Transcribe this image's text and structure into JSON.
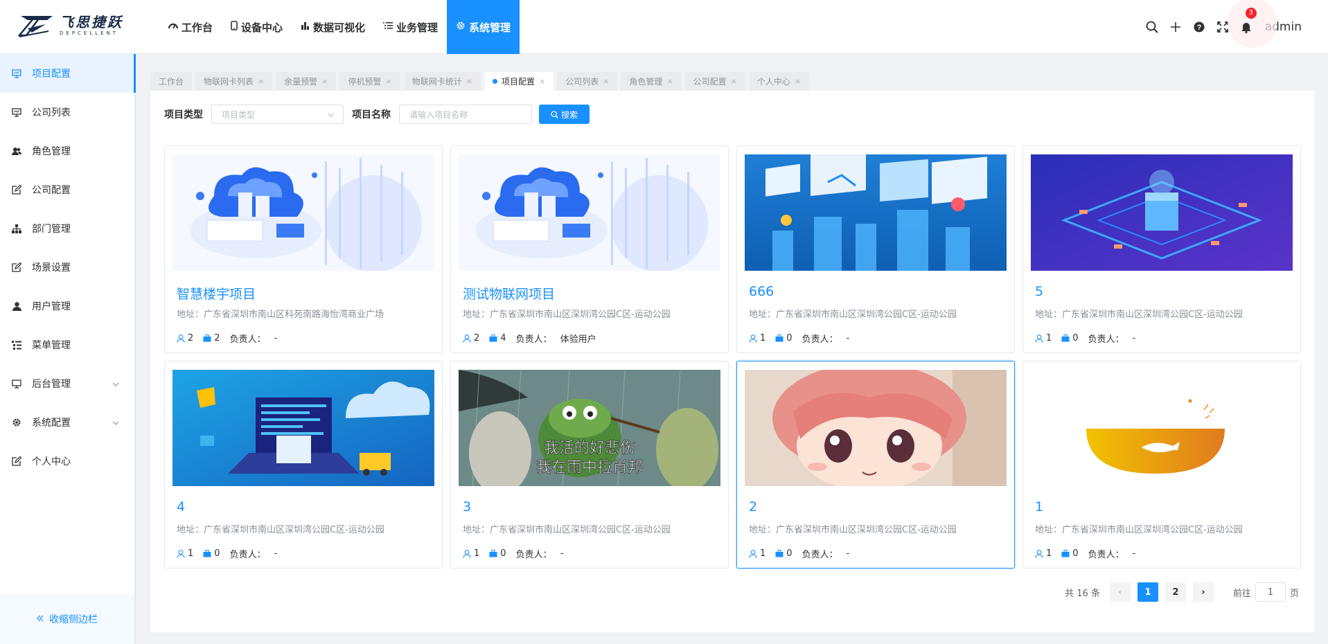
{
  "brand": {
    "name_cn": "飞思捷跃",
    "name_en": "DEPCELLENT"
  },
  "nav": [
    {
      "label": "工作台",
      "icon": "dashboard-icon"
    },
    {
      "label": "设备中心",
      "icon": "mobile-icon"
    },
    {
      "label": "数据可视化",
      "icon": "bar-chart-icon"
    },
    {
      "label": "业务管理",
      "icon": "list-icon"
    },
    {
      "label": "系统管理",
      "icon": "gear-icon",
      "active": true
    }
  ],
  "header": {
    "notification_count": "3",
    "username": "admin"
  },
  "sidebar": {
    "items": [
      {
        "label": "项目配置",
        "icon": "monitor-icon",
        "active": true
      },
      {
        "label": "公司列表",
        "icon": "monitor-icon"
      },
      {
        "label": "角色管理",
        "icon": "users-icon"
      },
      {
        "label": "公司配置",
        "icon": "edit-icon"
      },
      {
        "label": "部门管理",
        "icon": "org-tree-icon"
      },
      {
        "label": "场景设置",
        "icon": "edit-icon"
      },
      {
        "label": "用户管理",
        "icon": "user-icon"
      },
      {
        "label": "菜单管理",
        "icon": "menu-list-icon"
      },
      {
        "label": "后台管理",
        "icon": "monitor-icon",
        "expandable": true
      },
      {
        "label": "系统配置",
        "icon": "gear-icon",
        "expandable": true
      },
      {
        "label": "个人中心",
        "icon": "edit-icon"
      }
    ],
    "collapse_label": "收缩侧边栏"
  },
  "tabs": [
    {
      "label": "工作台"
    },
    {
      "label": "物联网卡列表"
    },
    {
      "label": "余量预警"
    },
    {
      "label": "停机预警"
    },
    {
      "label": "物联网卡统计"
    },
    {
      "label": "项目配置",
      "active": true
    },
    {
      "label": "公司列表"
    },
    {
      "label": "角色管理"
    },
    {
      "label": "公司配置"
    },
    {
      "label": "个人中心"
    }
  ],
  "search": {
    "type_label": "项目类型",
    "type_placeholder": "项目类型",
    "name_label": "项目名称",
    "name_placeholder": "请输入项目名称",
    "button_label": "搜索"
  },
  "projects": [
    {
      "title": "智慧楼宇项目",
      "address": "地址：广东省深圳市南山区科苑南路海怡湾商业广场",
      "members": "2",
      "devices": "2",
      "owner_label": "负责人：",
      "owner": "-",
      "image": "iot-cloud-isometric"
    },
    {
      "title": "测试物联网项目",
      "address": "地址：广东省深圳市南山区深圳湾公园C区-运动公园",
      "members": "2",
      "devices": "4",
      "owner_label": "负责人：",
      "owner": "体验用户",
      "image": "iot-cloud-isometric"
    },
    {
      "title": "666",
      "address": "地址：广东省深圳市南山区深圳湾公园C区-运动公园",
      "members": "1",
      "devices": "0",
      "owner_label": "负责人：",
      "owner": "-",
      "image": "blue-dashboards"
    },
    {
      "title": "5",
      "address": "地址：广东省深圳市南山区深圳湾公园C区-运动公园",
      "members": "1",
      "devices": "0",
      "owner_label": "负责人：",
      "owner": "-",
      "image": "purple-circuit"
    },
    {
      "title": "4",
      "address": "地址：广东省深圳市南山区深圳湾公园C区-运动公园",
      "members": "1",
      "devices": "0",
      "owner_label": "负责人：",
      "owner": "-",
      "image": "laptop-cloud"
    },
    {
      "title": "3",
      "address": "地址：广东省深圳市南山区深圳湾公园C区-运动公园",
      "members": "1",
      "devices": "0",
      "owner_label": "负责人：",
      "owner": "-",
      "image": "frog-meme",
      "image_caption_1": "我活的好悲伤",
      "image_caption_2": "我在雨中拉肖邦"
    },
    {
      "title": "2",
      "address": "地址：广东省深圳市南山区深圳湾公园C区-运动公园",
      "members": "1",
      "devices": "0",
      "owner_label": "负责人：",
      "owner": "-",
      "image": "anime-girl"
    },
    {
      "title": "1",
      "address": "地址：广东省深圳市南山区深圳湾公园C区-运动公园",
      "members": "1",
      "devices": "0",
      "owner_label": "负责人：",
      "owner": "-",
      "image": "yellow-bowl-fish"
    }
  ],
  "pagination": {
    "total_text": "共 16 条",
    "prev": "‹",
    "next": "›",
    "pages": [
      "1",
      "2"
    ],
    "current": "1",
    "goto_prefix": "前往",
    "goto_value": "1",
    "goto_suffix": "页"
  },
  "colors": {
    "primary": "#1890ff",
    "danger": "#f5222d"
  }
}
